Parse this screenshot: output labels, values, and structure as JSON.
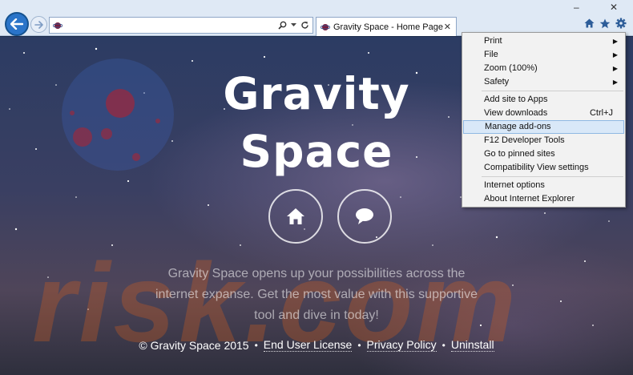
{
  "tab": {
    "title": "Gravity Space - Home Page",
    "close": "✕"
  },
  "window": {
    "minimize": "–",
    "close": "✕"
  },
  "hero": {
    "title_line1": "Gravity",
    "title_line2": "Space",
    "tagline": "Gravity Space opens up your possibilities across the internet expanse. Get the most value with this supportive tool and dive in today!"
  },
  "watermark": {
    "text": "risk.com"
  },
  "footer": {
    "copyright": "© Gravity Space 2015",
    "links": [
      "End User License",
      "Privacy Policy",
      "Uninstall"
    ]
  },
  "menu": {
    "items": [
      {
        "label": "Print",
        "submenu": true
      },
      {
        "label": "File",
        "submenu": true
      },
      {
        "label": "Zoom (100%)",
        "submenu": true
      },
      {
        "label": "Safety",
        "submenu": true
      },
      {
        "label": "Add site to Apps"
      },
      {
        "label": "View downloads",
        "shortcut": "Ctrl+J"
      },
      {
        "label": "Manage add-ons",
        "highlighted": true
      },
      {
        "label": "F12 Developer Tools"
      },
      {
        "label": "Go to pinned sites"
      },
      {
        "label": "Compatibility View settings"
      },
      {
        "label": "Internet options"
      },
      {
        "label": "About Internet Explorer"
      }
    ]
  },
  "icons": {
    "back": "arrow-left",
    "forward": "arrow-right",
    "search": "search",
    "refresh": "refresh",
    "home": "home",
    "favorites": "star",
    "tools": "gear",
    "chat": "speech-bubble"
  },
  "colors": {
    "accent": "#2a74c9",
    "menu_highlight": "#d9e8f8",
    "watermark": "#d25f1e"
  }
}
